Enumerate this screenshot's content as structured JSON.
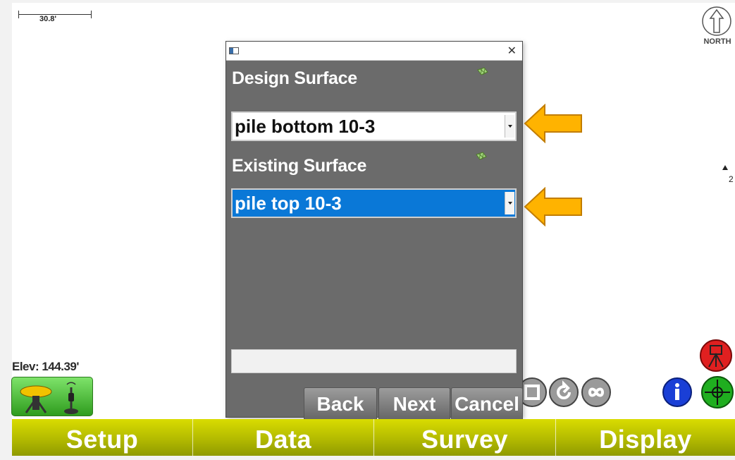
{
  "map": {
    "scale_label": "30.8'",
    "north_label": "NORTH",
    "point_label": "2",
    "elevation": "Elev: 144.39'"
  },
  "dialog": {
    "title": "",
    "design_surface_label": "Design Surface",
    "design_surface_value": "pile bottom 10-3",
    "existing_surface_label": "Existing Surface",
    "existing_surface_value": "pile top 10-3",
    "status_text": "",
    "buttons": {
      "back": "Back",
      "next": "Next",
      "cancel": "Cancel"
    }
  },
  "bottom_nav": [
    "Setup",
    "Data",
    "Survey",
    "Display"
  ],
  "colors": {
    "nav_bar": "#b3ba00",
    "dialog_bg": "#6b6b6b",
    "selected_blue": "#0a78d7",
    "hint_arrow": "#ffb300"
  },
  "icons": [
    "north-arrow-icon",
    "surface-icon",
    "gps-receiver-icon",
    "undo-icon",
    "infinity-icon",
    "info-icon",
    "crosshair-icon",
    "tripod-icon"
  ]
}
